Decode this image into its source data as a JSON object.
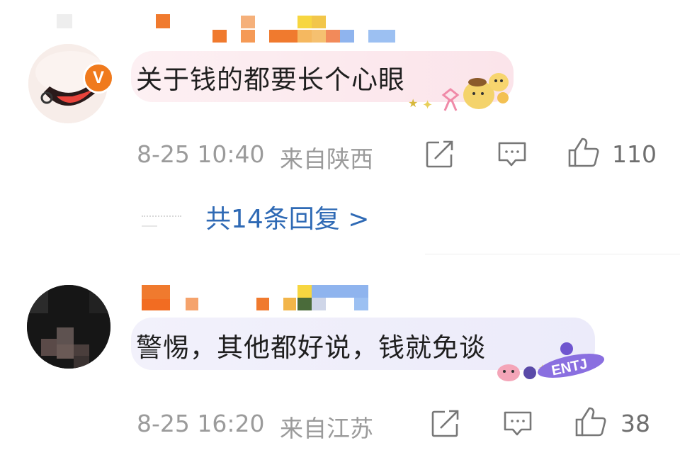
{
  "comments": [
    {
      "content": "关于钱的都要长个心眼",
      "date": "8-25 10:40",
      "location": "来自陕西",
      "likes": "110",
      "verified_badge": "V",
      "replies_link": "共14条回复 >",
      "colors": {
        "bubble": "#fce9ee",
        "badge": "#f07a1d"
      },
      "icons": [
        "share-icon",
        "comment-icon",
        "like-icon"
      ]
    },
    {
      "content": "警惕，其他都好说，钱就免谈",
      "date": "8-25 16:20",
      "location": "来自江苏",
      "likes": "38",
      "sticker_text": "ENTJ",
      "colors": {
        "bubble": "#eeedfb",
        "sticker": "#8a6fe0"
      },
      "icons": [
        "share-icon",
        "comment-icon",
        "like-icon"
      ]
    }
  ],
  "colors": {
    "link": "#2f6ab5",
    "meta": "#9b9b9b"
  }
}
